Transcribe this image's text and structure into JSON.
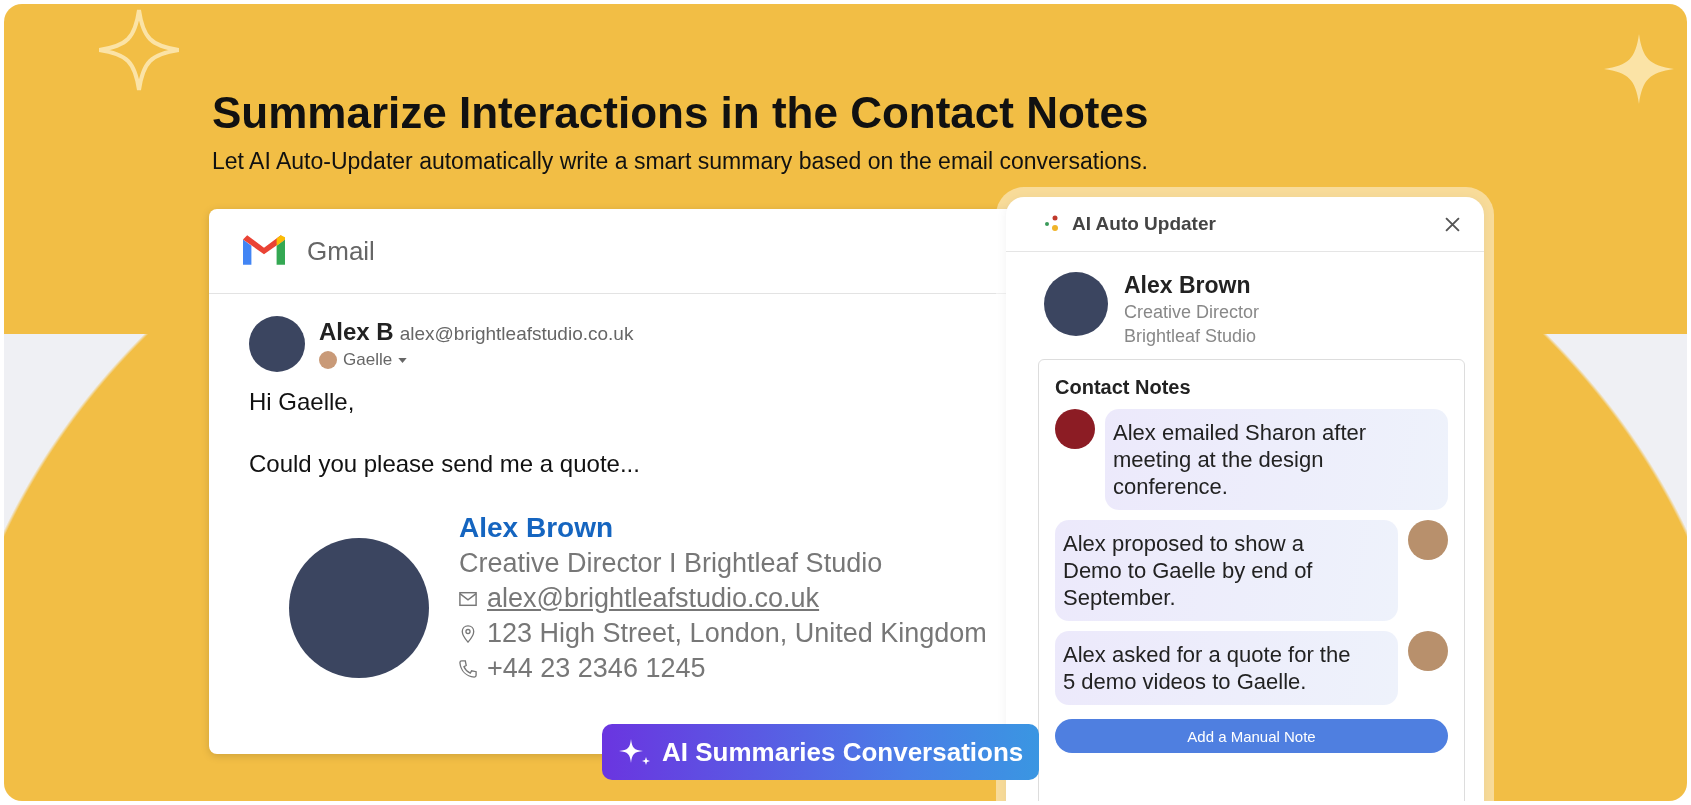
{
  "banner": {
    "title": "Summarize Interactions in the Contact Notes",
    "subtitle": "Let AI Auto-Updater automatically write a smart summary based on the email conversations."
  },
  "email": {
    "app_name": "Gmail",
    "sender_name": "Alex B",
    "sender_email": "alex@brightleafstudio.co.uk",
    "recipient": "Gaelle",
    "greeting": "Hi Gaelle,",
    "body": "Could you please send me a quote...",
    "signature": {
      "name": "Alex Brown",
      "title": "Creative Director I Brightleaf Studio",
      "email": "alex@brightleafstudio.co.uk",
      "address": "123 High Street, London, United Kingdom",
      "phone": "+44 23 2346 1245"
    }
  },
  "panel": {
    "title": "AI Auto Updater",
    "contact": {
      "name": "Alex Brown",
      "role": "Creative Director",
      "company": "Brightleaf Studio"
    },
    "notes_title": "Contact Notes",
    "notes": [
      {
        "kind": "left",
        "text": "Alex emailed Sharon after meeting at the design conference."
      },
      {
        "kind": "right",
        "text": "Alex proposed to show a Demo to Gaelle by end of September."
      },
      {
        "kind": "right",
        "text": "Alex asked for a quote for the 5 demo videos to Gaelle."
      }
    ],
    "button": "Add a Manual Note"
  },
  "badge": "AI Summaries Conversations"
}
